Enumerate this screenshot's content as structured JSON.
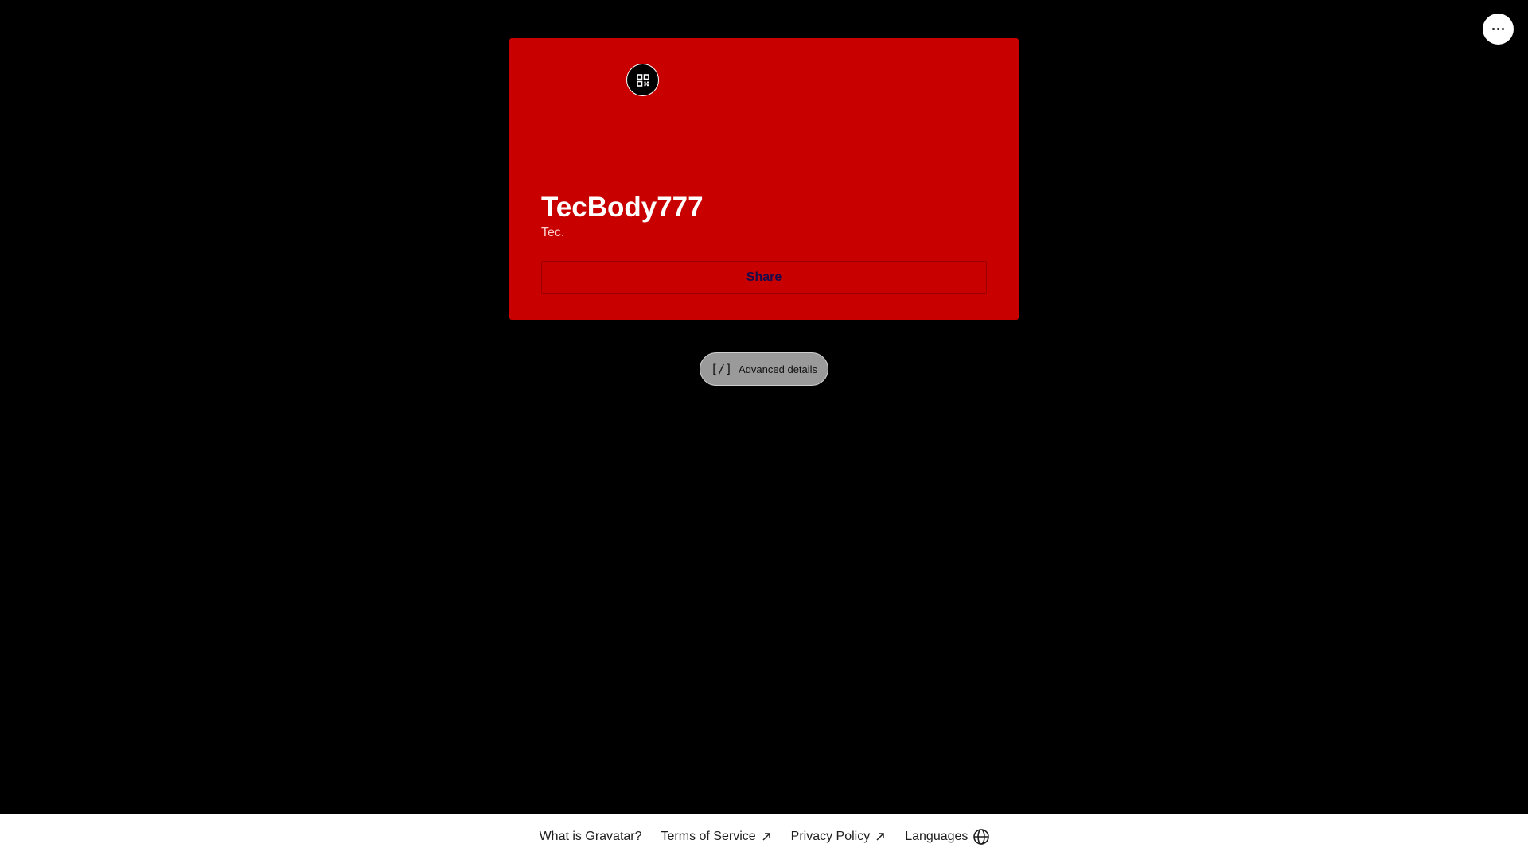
{
  "header": {
    "more_icon": "more-horizontal-icon"
  },
  "profile": {
    "qr_icon": "qr-code-icon",
    "display_name": "TecBody777",
    "tagline": "Tec.",
    "share_label": "Share",
    "background_color": "#c80000"
  },
  "advanced": {
    "icon": "code-icon",
    "icon_text": "[/]",
    "label": "Advanced details"
  },
  "footer": {
    "links": [
      {
        "label": "What is Gravatar?",
        "icon": ""
      },
      {
        "label": "Terms of Service",
        "icon": "external-arrow-icon"
      },
      {
        "label": "Privacy Policy",
        "icon": "external-arrow-icon"
      },
      {
        "label": "Languages",
        "icon": "globe-icon"
      }
    ]
  }
}
